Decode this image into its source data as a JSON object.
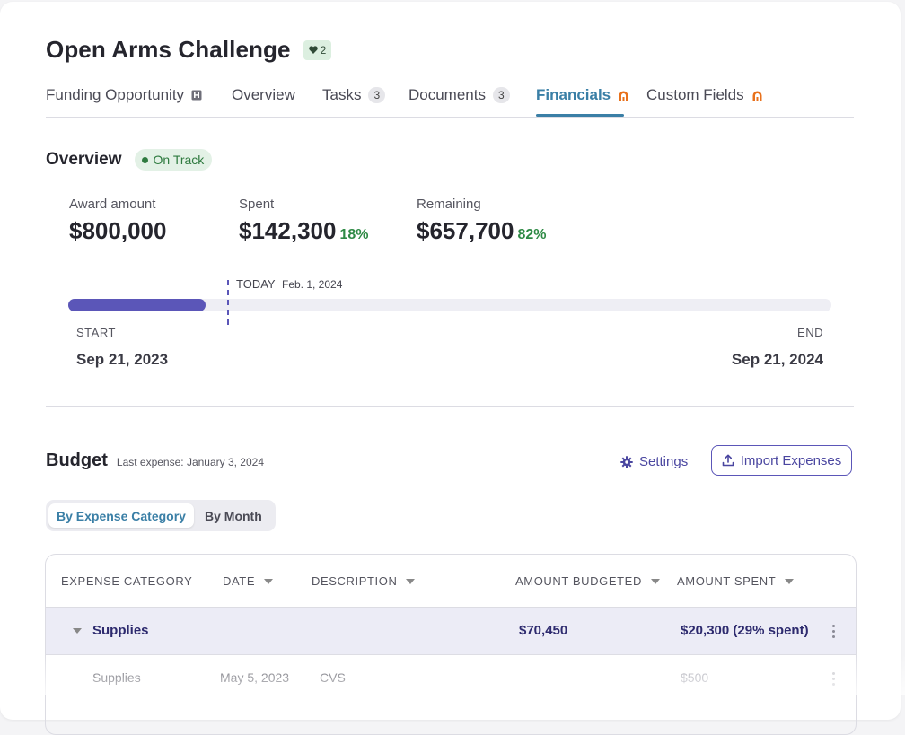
{
  "header": {
    "title": "Open Arms Challenge",
    "favorites_count": "2"
  },
  "tabs": [
    {
      "label": "Funding Opportunity"
    },
    {
      "label": "Overview"
    },
    {
      "label": "Tasks",
      "count": "3"
    },
    {
      "label": "Documents",
      "count": "3"
    },
    {
      "label": "Financials",
      "active": true
    },
    {
      "label": "Custom Fields"
    }
  ],
  "overview": {
    "title": "Overview",
    "status": "On Track",
    "award": {
      "label": "Award amount",
      "value": "$800,000"
    },
    "spent": {
      "label": "Spent",
      "value": "$142,300",
      "pct": "18%"
    },
    "remaining": {
      "label": "Remaining",
      "value": "$657,700",
      "pct": "82%"
    },
    "timeline": {
      "today_label": "TODAY",
      "today_date": "Feb. 1, 2024",
      "start_label": "START",
      "start_date": "Sep 21, 2023",
      "end_label": "END",
      "end_date": "Sep 21, 2024",
      "progress_fraction": 0.18
    }
  },
  "budget": {
    "title": "Budget",
    "last_expense": "Last expense: January 3, 2024",
    "settings_label": "Settings",
    "import_label": "Import Expenses",
    "view_toggle": [
      "By Expense Category",
      "By Month"
    ],
    "columns": [
      "EXPENSE CATEGORY",
      "DATE",
      "DESCRIPTION",
      "AMOUNT BUDGETED",
      "AMOUNT SPENT"
    ],
    "group": {
      "name": "Supplies",
      "budgeted": "$70,450",
      "spent": "$20,300 (29% spent)"
    },
    "rows": [
      {
        "category": "Supplies",
        "date": "May 5, 2023",
        "description": "CVS",
        "spent": "$500"
      }
    ]
  },
  "colors": {
    "accent": "#3a7fa6",
    "brand": "#5b56b8",
    "success": "#2e8a45",
    "external": "#e8711c"
  }
}
